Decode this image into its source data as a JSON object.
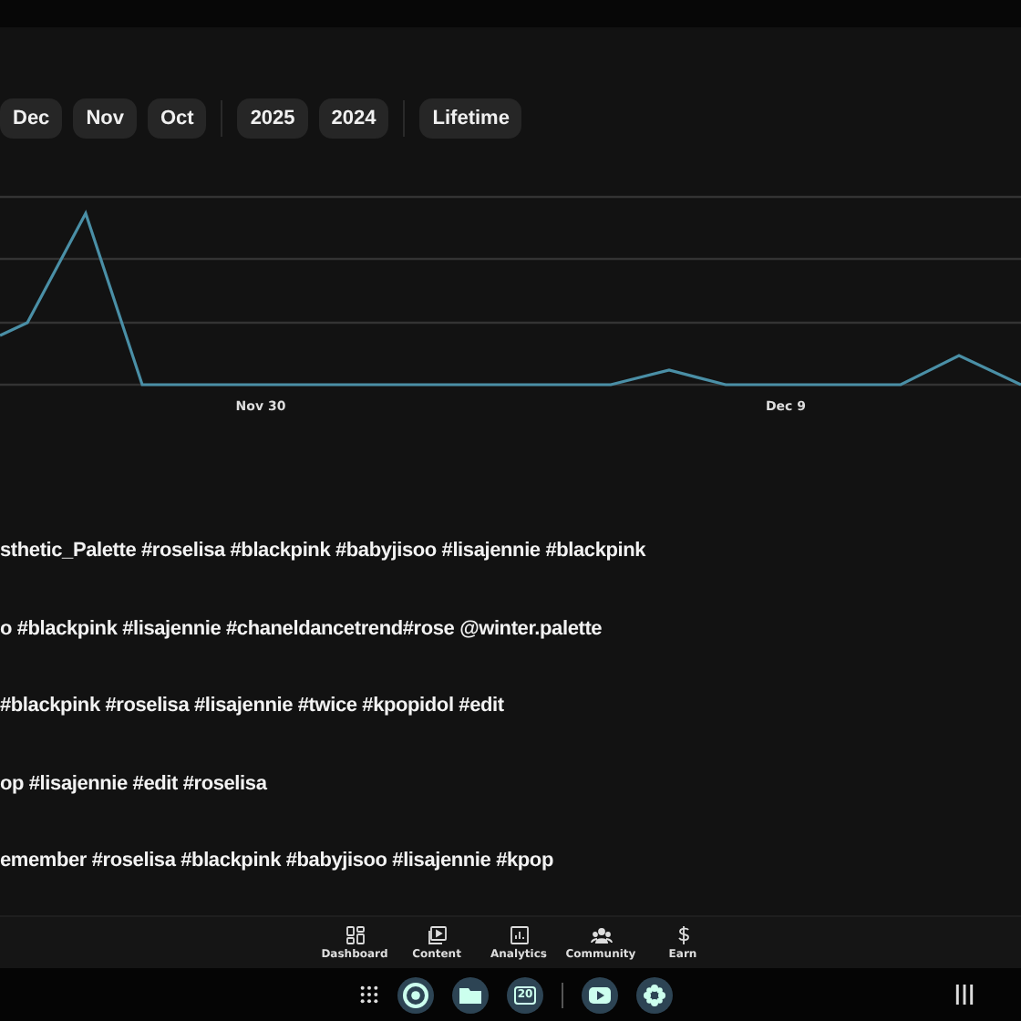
{
  "period_groups": [
    [
      "Dec",
      "Nov",
      "Oct"
    ],
    [
      "2025",
      "2024"
    ],
    [
      "Lifetime"
    ]
  ],
  "chart": {
    "x_labels": [
      "Nov 30",
      "Dec 9"
    ]
  },
  "posts": [
    "sthetic_Palette  #roselisa #blackpink #babyjisoo #lisajennie #blackpink",
    "o #blackpink #lisajennie #chaneldancetrend#rose @winter.palette",
    "#blackpink #roselisa #lisajennie #twice #kpopidol #edit",
    "op #lisajennie #edit #roselisa",
    "emember #roselisa #blackpink #babyjisoo #lisajennie #kpop"
  ],
  "nav": [
    "Dashboard",
    "Content",
    "Analytics",
    "Community",
    "Earn"
  ],
  "taskbar": {
    "calendar_day": "20"
  }
}
